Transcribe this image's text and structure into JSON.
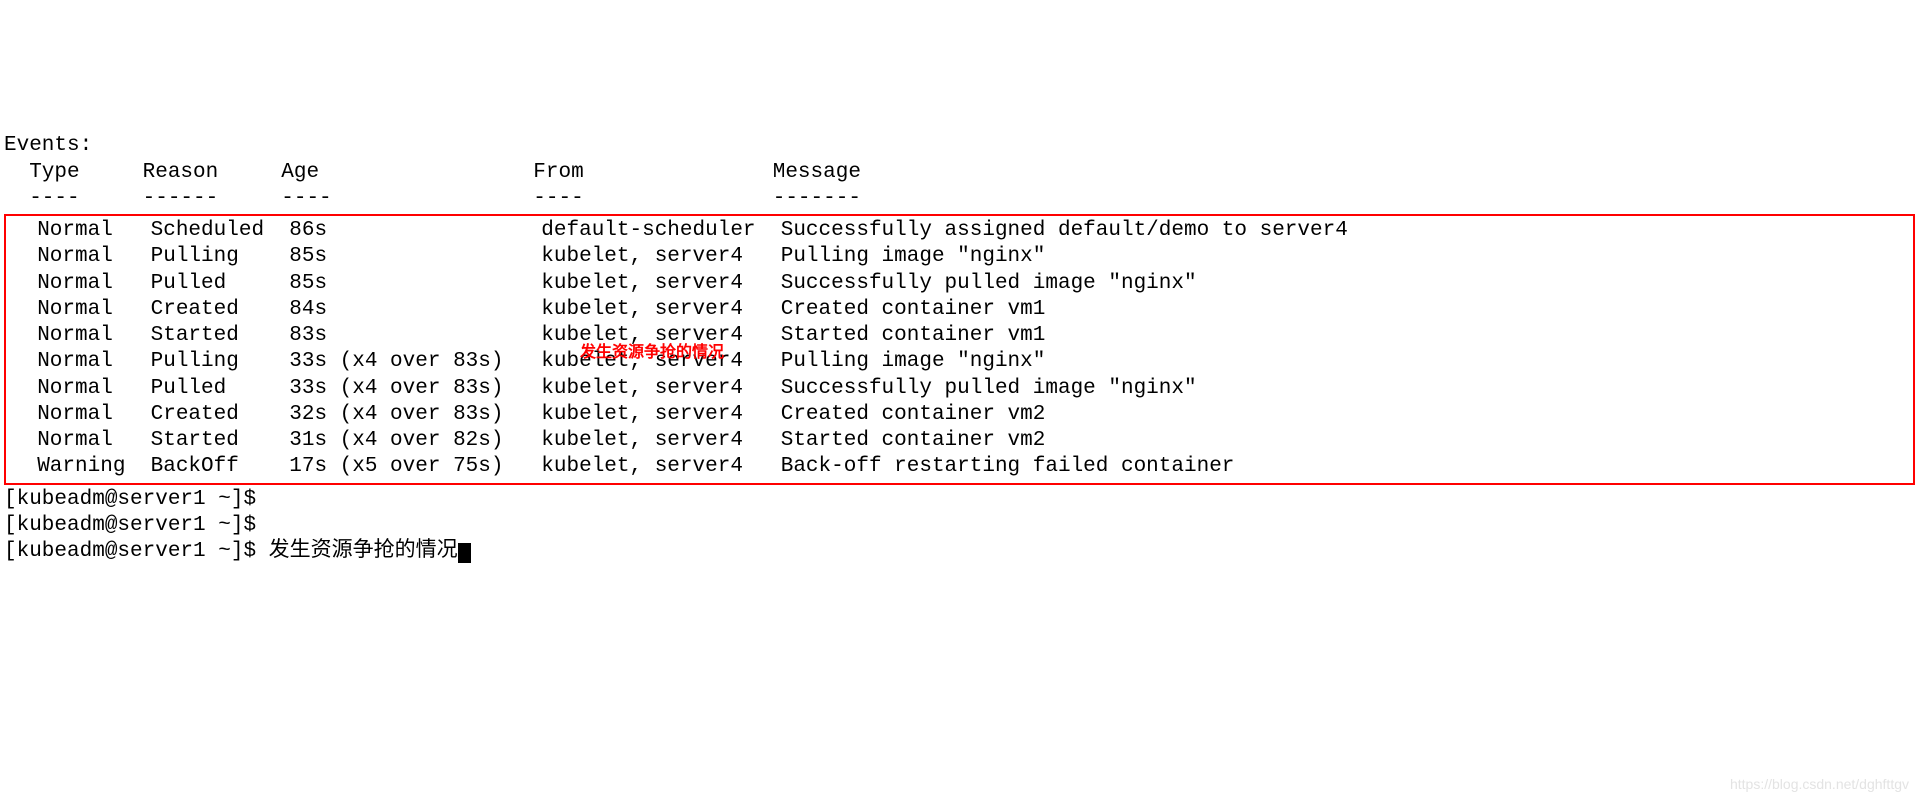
{
  "header_line": "Events:",
  "columns_line": "  Type     Reason     Age                 From               Message",
  "separator_line": "  ----     ------     ----                ----               -------",
  "events": [
    "  Normal   Scheduled  86s                 default-scheduler  Successfully assigned default/demo to server4",
    "  Normal   Pulling    85s                 kubelet, server4   Pulling image \"nginx\"",
    "  Normal   Pulled     85s                 kubelet, server4   Successfully pulled image \"nginx\"",
    "  Normal   Created    84s                 kubelet, server4   Created container vm1",
    "  Normal   Started    83s                 kubelet, server4   Started container vm1",
    "  Normal   Pulling    33s (x4 over 83s)   kubelet, server4   Pulling image \"nginx\"",
    "  Normal   Pulled     33s (x4 over 83s)   kubelet, server4   Successfully pulled image \"nginx\"",
    "  Normal   Created    32s (x4 over 83s)   kubelet, server4   Created container vm2",
    "  Normal   Started    31s (x4 over 82s)   kubelet, server4   Started container vm2",
    "  Warning  BackOff    17s (x5 over 75s)   kubelet, server4   Back-off restarting failed container"
  ],
  "annotation": "发生资源争抢的情况",
  "prompts": [
    "[kubeadm@server1 ~]$ ",
    "[kubeadm@server1 ~]$ ",
    "[kubeadm@server1 ~]$ 发生资源争抢的情况"
  ],
  "watermark": "https://blog.csdn.net/dghfttgv"
}
